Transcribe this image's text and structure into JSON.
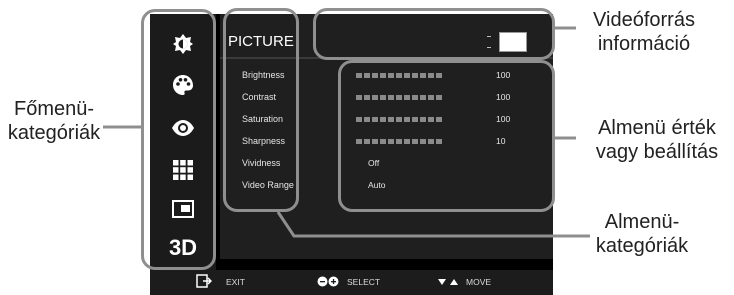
{
  "menu": {
    "title": "PICTURE",
    "items": [
      {
        "label": "Brightness",
        "value": "100",
        "bar": true
      },
      {
        "label": "Contrast",
        "value": "100",
        "bar": true
      },
      {
        "label": "Saturation",
        "value": "100",
        "bar": true
      },
      {
        "label": "Sharpness",
        "value": "10",
        "bar": true
      },
      {
        "label": "Vividness",
        "value": "Off",
        "bar": false
      },
      {
        "label": "Video Range",
        "value": "Auto",
        "bar": false
      }
    ]
  },
  "sidebar": {
    "icons": [
      "brightness-icon",
      "palette-icon",
      "eye-icon",
      "grid-icon",
      "window-icon",
      "3d-icon"
    ],
    "three_d_label": "3D"
  },
  "footer": {
    "exit_label": "EXIT",
    "select_label": "SELECT",
    "move_label": "MOVE"
  },
  "annotations": {
    "main_categories": "Főmenü-\nkategóriák",
    "source_info": "Videóforrás\ninformáció",
    "submenu_value": "Almenü érték\nvagy beállítás",
    "submenu_categories": "Almenü-\nkategóriák"
  },
  "colors": {
    "frame": "#8f8f8f",
    "osd_background": "#000000"
  }
}
